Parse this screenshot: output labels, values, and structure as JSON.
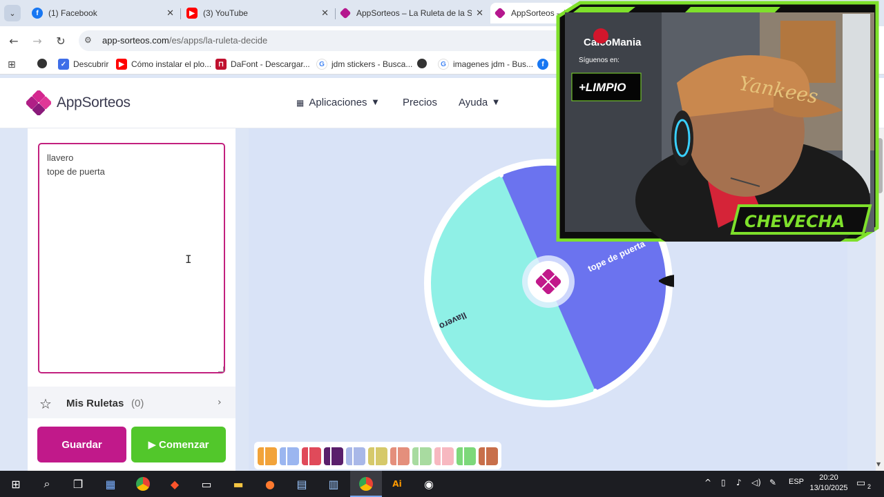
{
  "browser": {
    "tabs": [
      {
        "label": "(1) Facebook",
        "icon": "facebook-icon",
        "color": "#1877f2"
      },
      {
        "label": "(3) YouTube",
        "icon": "youtube-icon",
        "color": "#ff0000"
      },
      {
        "label": "AppSorteos – La Ruleta de la S",
        "icon": "appsorteos-icon",
        "color": "#b5178e"
      },
      {
        "label": "AppSorteos – La",
        "icon": "appsorteos-icon",
        "color": "#b5178e"
      }
    ],
    "url_domain": "app-sorteos.com",
    "url_path": "/es/apps/la-ruleta-decide",
    "bookmarks": [
      {
        "label": "",
        "icon": "globe-icon"
      },
      {
        "label": "Descubrir",
        "icon": "descubrir-icon"
      },
      {
        "label": "Cómo instalar el plo...",
        "icon": "youtube-icon"
      },
      {
        "label": "DaFont - Descargar...",
        "icon": "dafont-icon"
      },
      {
        "label": "jdm stickers - Busca...",
        "icon": "google-icon"
      },
      {
        "label": "",
        "icon": "globe-icon"
      },
      {
        "label": "imagenes jdm - Bus...",
        "icon": "google-icon"
      },
      {
        "label": "",
        "icon": "facebook-icon"
      }
    ]
  },
  "site": {
    "brand": "AppSorteos",
    "nav": {
      "aplicaciones": "Aplicaciones",
      "precios": "Precios",
      "ayuda": "Ayuda"
    }
  },
  "panel": {
    "entries": [
      "llavero",
      "tope de puerta"
    ],
    "mis_ruletas_label": "Mis Ruletas",
    "mis_ruletas_count": "(0)",
    "guardar_label": "Guardar",
    "comenzar_label": "Comenzar"
  },
  "wheel": {
    "segments": [
      {
        "label": "llavero",
        "color": "#8ff0e6"
      },
      {
        "label": "tope de puerta",
        "color": "#6b73ef"
      }
    ],
    "accent": "#b5178e"
  },
  "palette_colors": [
    "#f2a33a",
    "#9bb6f0",
    "#e04a5a",
    "#5a1f6b",
    "#a9b8e8",
    "#d6c96a",
    "#e48f7c",
    "#a8dba0",
    "#f7b8c0",
    "#7dd87a",
    "#c86f4a"
  ],
  "webcam": {
    "brand_text": "CalcoMania",
    "follow_text": "Síguenos en:",
    "sponsor_text": "+LIMPIO",
    "streamer_name": "CHEVECHA",
    "cap_text": "Yankees"
  },
  "taskbar": {
    "language": "ESP",
    "time": "20:20",
    "date": "13/10/2025",
    "notification_count": "2"
  }
}
